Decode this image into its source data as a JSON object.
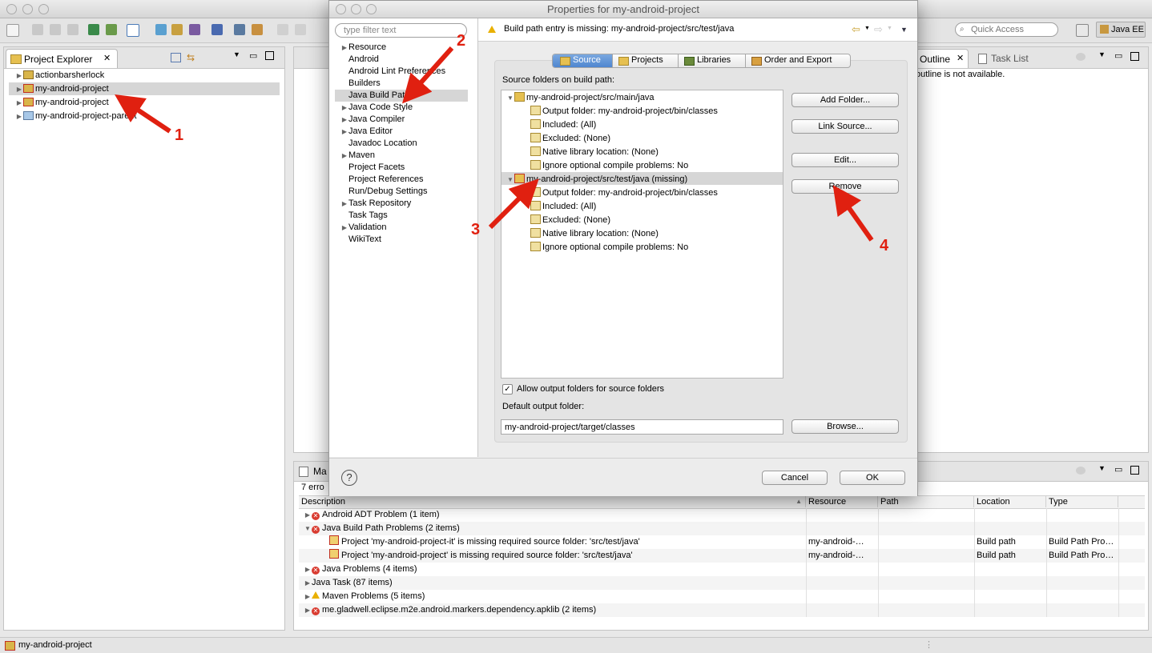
{
  "app": {
    "quick_access_placeholder": "Quick Access",
    "perspective": "Java EE",
    "status_bar": "my-android-project"
  },
  "explorer": {
    "title": "Project Explorer",
    "items": [
      {
        "label": "actionbarsherlock"
      },
      {
        "label": "my-android-project"
      },
      {
        "label": "my-android-project"
      },
      {
        "label": "my-android-project-parent"
      }
    ]
  },
  "outline": {
    "tab_outline": "Outline",
    "tab_tasklist": "Task List",
    "message": "outline is not available."
  },
  "markers": {
    "tab": "Ma",
    "summary": "7 erro",
    "columns": [
      "Description",
      "Resource",
      "Path",
      "Location",
      "Type"
    ],
    "rows": [
      {
        "desc": "Android ADT Problem (1 item)",
        "res": "",
        "path": "",
        "loc": "",
        "type": ""
      },
      {
        "desc": "Java Build Path Problems (2 items)",
        "res": "",
        "path": "",
        "loc": "",
        "type": ""
      },
      {
        "desc": "Project 'my-android-project-it' is missing required source folder: 'src/test/java'",
        "res": "my-android-…",
        "path": "",
        "loc": "Build path",
        "type": "Build Path Pro…"
      },
      {
        "desc": "Project 'my-android-project' is missing required source folder: 'src/test/java'",
        "res": "my-android-…",
        "path": "",
        "loc": "Build path",
        "type": "Build Path Pro…"
      },
      {
        "desc": "Java Problems (4 items)",
        "res": "",
        "path": "",
        "loc": "",
        "type": ""
      },
      {
        "desc": "Java Task (87 items)",
        "res": "",
        "path": "",
        "loc": "",
        "type": ""
      },
      {
        "desc": "Maven Problems (5 items)",
        "res": "",
        "path": "",
        "loc": "",
        "type": ""
      },
      {
        "desc": "me.gladwell.eclipse.m2e.android.markers.dependency.apklib (2 items)",
        "res": "",
        "path": "",
        "loc": "",
        "type": ""
      }
    ]
  },
  "dialog": {
    "title": "Properties for my-android-project",
    "filter_placeholder": "type filter text",
    "warning": "Build path entry is missing: my-android-project/src/test/java",
    "nav": [
      "Resource",
      "Android",
      "Android Lint Preferences",
      "Builders",
      "Java Build Path",
      "Java Code Style",
      "Java Compiler",
      "Java Editor",
      "Javadoc Location",
      "Maven",
      "Project Facets",
      "Project References",
      "Run/Debug Settings",
      "Task Repository",
      "Task Tags",
      "Validation",
      "WikiText"
    ],
    "tabs": [
      "Source",
      "Projects",
      "Libraries",
      "Order and Export"
    ],
    "source_label": "Source folders on build path:",
    "tree": [
      "my-android-project/src/main/java",
      "Output folder: my-android-project/bin/classes",
      "Included: (All)",
      "Excluded: (None)",
      "Native library location: (None)",
      "Ignore optional compile problems: No",
      "my-android-project/src/test/java (missing)",
      "Output folder: my-android-project/bin/classes",
      "Included: (All)",
      "Excluded: (None)",
      "Native library location: (None)",
      "Ignore optional compile problems: No"
    ],
    "buttons": {
      "add_folder": "Add Folder...",
      "link_source": "Link Source...",
      "edit": "Edit...",
      "remove": "Remove",
      "browse": "Browse...",
      "cancel": "Cancel",
      "ok": "OK"
    },
    "allow_output": "Allow output folders for source folders",
    "default_output_label": "Default output folder:",
    "default_output_value": "my-android-project/target/classes",
    "help": "?"
  },
  "callouts": [
    "1",
    "2",
    "3",
    "4"
  ],
  "colors": {
    "accent_arrow": "#e02010",
    "selection": "#d6d6d6",
    "error": "#d93b30",
    "warning": "#e9b000"
  }
}
